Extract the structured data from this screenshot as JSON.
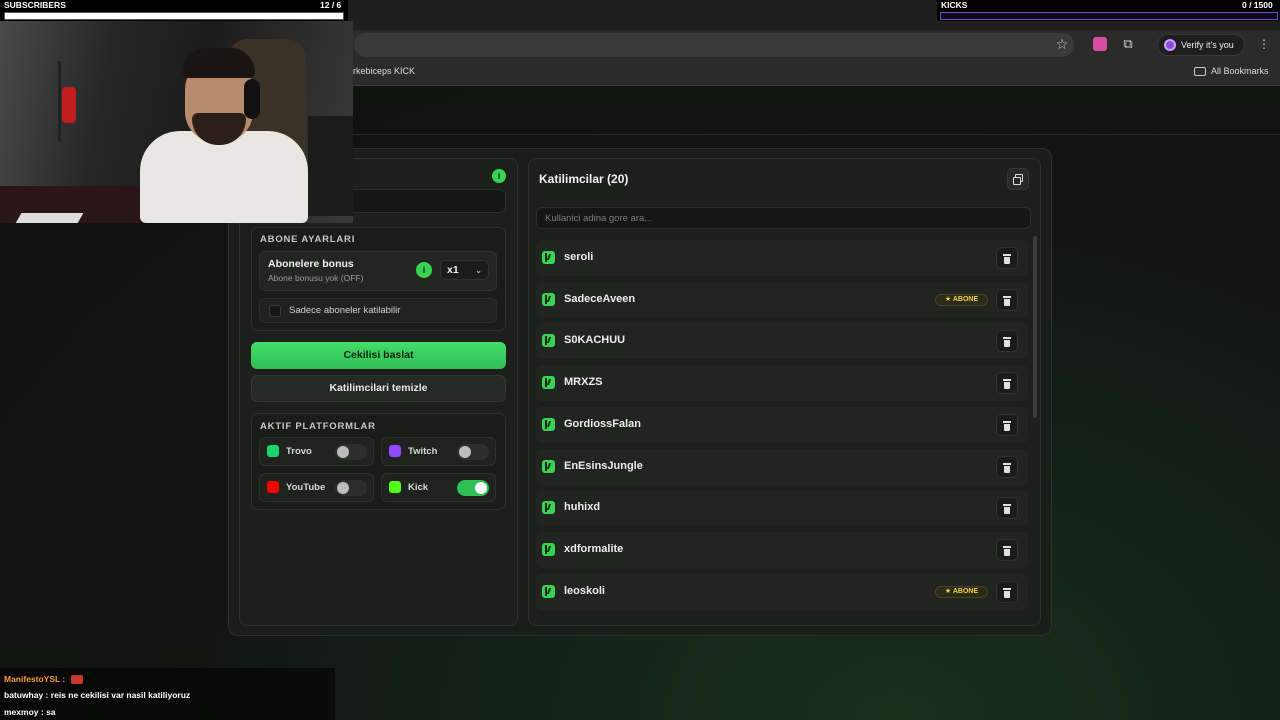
{
  "browser": {
    "bookmark_item": "erkebiceps KICK",
    "all_bookmarks": "All Bookmarks",
    "verify_label": "Verify it's you"
  },
  "overlay": {
    "subs_label": "SUBSCRIBERS",
    "subs_count": "12  / 6",
    "kicks_label": "KICKS",
    "kicks_count": "0  / 1500",
    "subs_progress": 1.0,
    "kicks_progress": 0.0,
    "colors": {
      "kicks_bar_border": "#7c46d6"
    }
  },
  "settings": {
    "abone_section_title": "ABONE AYARLARI",
    "bonus_title": "Abonelere bonus",
    "bonus_sub": "Abone bonusu yok (OFF)",
    "bonus_info": "i",
    "multiplier": "x1",
    "subs_only_label": "Sadece aboneler katilabilir",
    "subs_only_checked": false,
    "start_button": "Cekilisi baslat",
    "clear_button": "Katilimcilari temizle",
    "platforms_title": "AKTIF PLATFORMLAR",
    "platforms": [
      {
        "name": "Trovo",
        "enabled": false,
        "icon": "trovo-icon",
        "color": "#19d66b"
      },
      {
        "name": "Twitch",
        "enabled": false,
        "icon": "twitch-icon",
        "color": "#9146ff"
      },
      {
        "name": "YouTube",
        "enabled": false,
        "icon": "youtube-icon",
        "color": "#ff0000"
      },
      {
        "name": "Kick",
        "enabled": true,
        "icon": "kick-icon",
        "color": "#53fc18"
      }
    ],
    "info_dot": "i"
  },
  "participants": {
    "title": "Katilimcilar (20)",
    "search_placeholder": "Kullanici adina gore ara...",
    "badge_label": "ABONE",
    "list": [
      {
        "name": "seroli",
        "subscriber": false
      },
      {
        "name": "SadeceAveen",
        "subscriber": true
      },
      {
        "name": "S0KACHUU",
        "subscriber": false
      },
      {
        "name": "MRXZS",
        "subscriber": false
      },
      {
        "name": "GordiossFalan",
        "subscriber": false
      },
      {
        "name": "EnEsinsJungle",
        "subscriber": false
      },
      {
        "name": "huhixd",
        "subscriber": false
      },
      {
        "name": "xdformalite",
        "subscriber": false
      },
      {
        "name": "leoskoli",
        "subscriber": true
      }
    ]
  },
  "chat": [
    {
      "user": "ManifestoYSL :",
      "message": "",
      "color": "#ff9a3c"
    },
    {
      "user": "batuwhay :",
      "message": "reis ne cekilisi var nasil katiliyoruz",
      "color": "#ffffff"
    },
    {
      "user": "mexmoy :",
      "message": "sa",
      "color": "#ffffff"
    }
  ]
}
